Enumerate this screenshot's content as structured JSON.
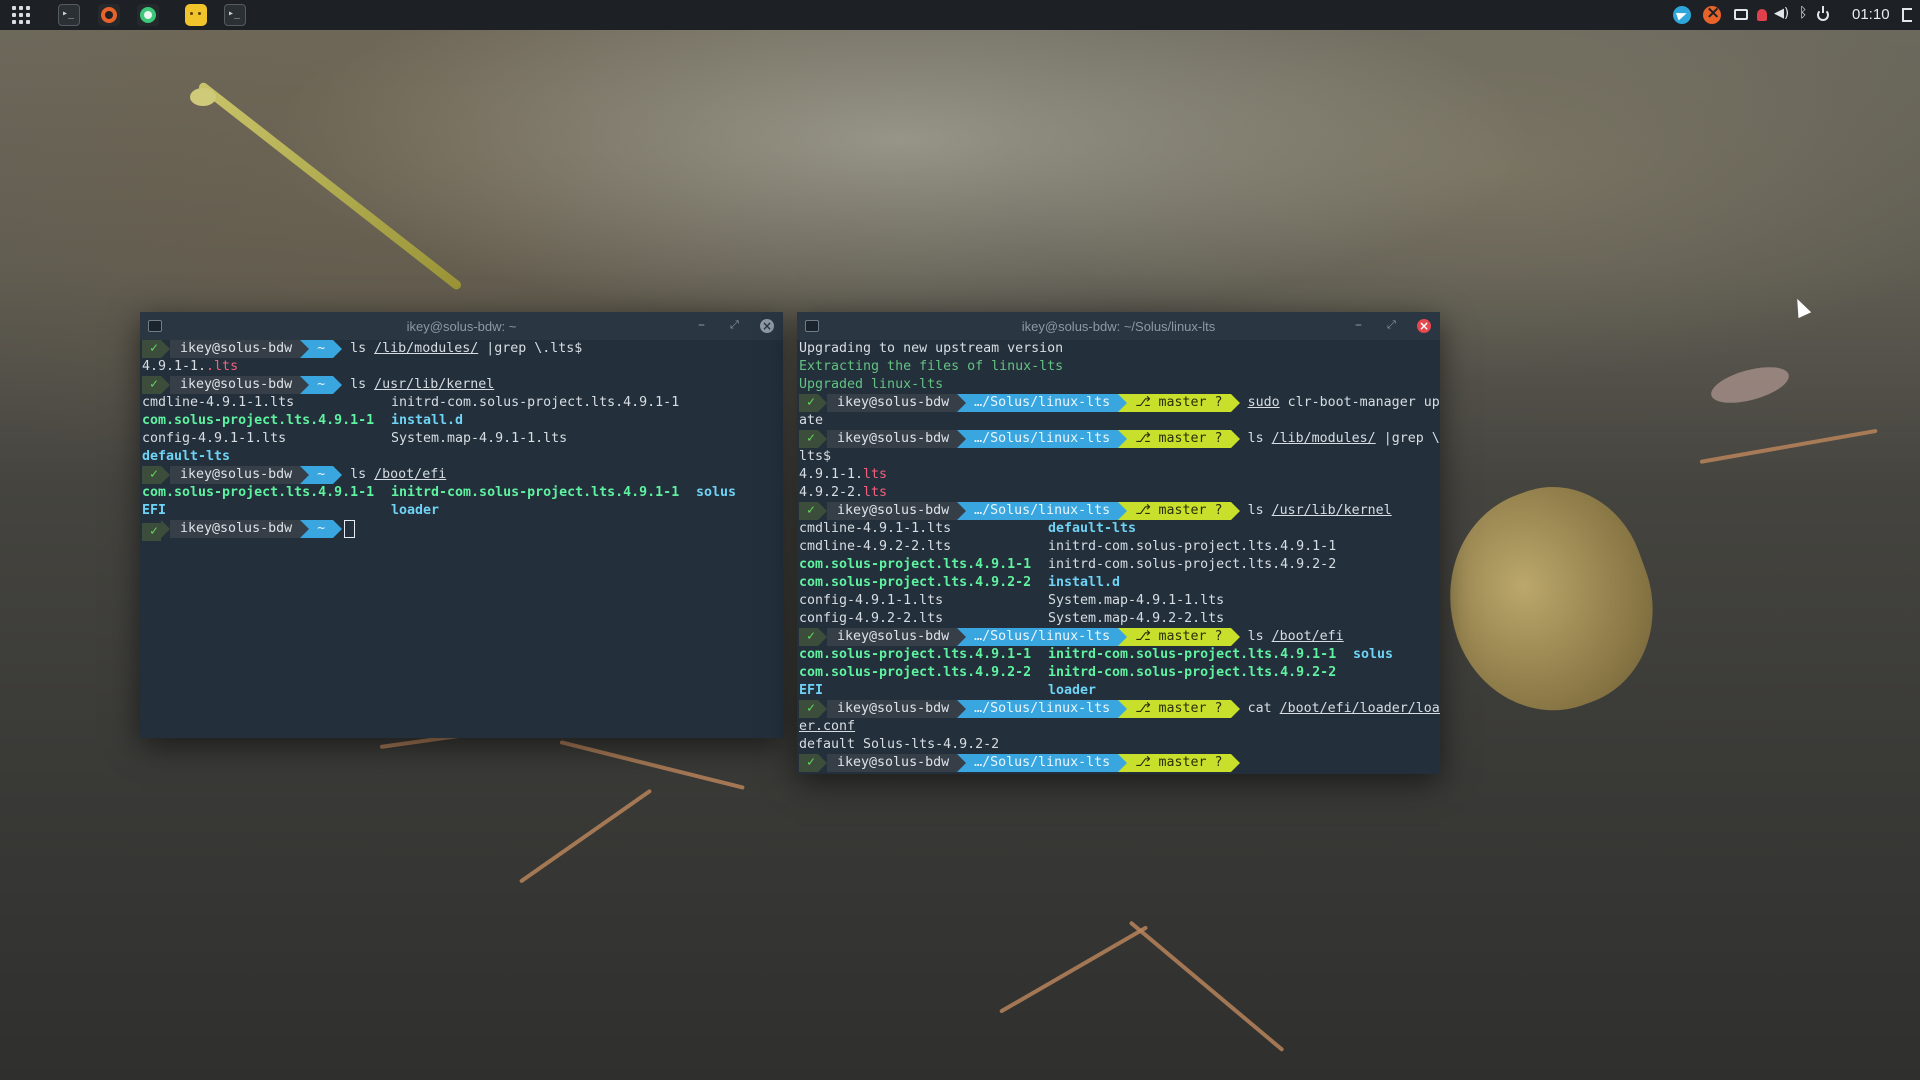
{
  "taskbar": {
    "launcher_icon": "apps-grid-icon",
    "apps": [
      {
        "name": "terminal-icon",
        "label": "▸_"
      },
      {
        "name": "hexchat-icon"
      },
      {
        "name": "chrome-green-icon"
      },
      {
        "name": "emoji-app-icon"
      },
      {
        "name": "terminal-icon",
        "label": "▸_"
      }
    ],
    "tray": [
      "telegram-icon",
      "status-x-icon",
      "screen-icon",
      "notification-bell-icon",
      "volume-icon",
      "bluetooth-icon",
      "power-icon"
    ],
    "clock": "01:10",
    "logout_icon": "logout-icon"
  },
  "colors": {
    "panel": "#1d2125",
    "terminal_bg": "#232f3a",
    "prompt_dir": "#39a6e0",
    "prompt_git": "#c8df2c",
    "exe_green": "#5ff2a0",
    "dir_cyan": "#6fd3f5"
  },
  "window1": {
    "title": "ikey@solus-bdw: ~",
    "min": "–",
    "max": "⤢",
    "close": "×",
    "lines": [
      {
        "user": "ikey@solus-bdw",
        "dir": "~",
        "cmd": "ls",
        "arg1": "/lib/modules/",
        "rest": " |grep \\.lts$"
      },
      {
        "a": "4.9.1-1.",
        "b": ".lts"
      },
      {
        "user": "ikey@solus-bdw",
        "dir": "~",
        "cmd": "ls",
        "arg1": "/usr/lib/kernel"
      },
      {
        "c1": "cmdline-4.9.1-1.lts",
        "c2": "initrd-com.solus-project.lts.4.9.1-1"
      },
      {
        "c1": "com.solus-project.lts.4.9.1-1",
        "c2": "install.d"
      },
      {
        "c1": "config-4.9.1-1.lts",
        "c2": "System.map-4.9.1-1.lts"
      },
      {
        "c1": "default-lts"
      },
      {
        "user": "ikey@solus-bdw",
        "dir": "~",
        "cmd": "ls",
        "arg1": "/boot/efi"
      },
      {
        "c1": "com.solus-project.lts.4.9.1-1",
        "c2": "initrd-com.solus-project.lts.4.9.1-1",
        "c3": "solus"
      },
      {
        "c1": "EFI",
        "c2": "loader"
      },
      {
        "user": "ikey@solus-bdw",
        "dir": "~"
      }
    ]
  },
  "window2": {
    "title": "ikey@solus-bdw: ~/Solus/linux-lts",
    "min": "–",
    "max": "⤢",
    "close": "×",
    "prompt_user": "ikey@solus-bdw",
    "prompt_dir": "…/Solus/linux-lts",
    "prompt_git": "master ?",
    "lines": [
      "Upgrading to new upstream version",
      "Extracting the files of linux-lts",
      "Upgraded linux-lts",
      {
        "cmd": "sudo",
        "rest": " clr-boot-manager upd"
      },
      "ate",
      {
        "cmd": "ls",
        "arg1": "/lib/modules/",
        "rest": " |grep \\."
      },
      "lts$",
      {
        "a": "4.9.1-1.",
        "b": "lts"
      },
      {
        "a": "4.9.2-2.",
        "b": "lts"
      },
      {
        "cmd": "ls",
        "arg1": "/usr/lib/kernel"
      },
      {
        "c1": "cmdline-4.9.1-1.lts",
        "c2": "default-lts"
      },
      {
        "c1": "cmdline-4.9.2-2.lts",
        "c2": "initrd-com.solus-project.lts.4.9.1-1"
      },
      {
        "c1": "com.solus-project.lts.4.9.1-1",
        "c2": "initrd-com.solus-project.lts.4.9.2-2"
      },
      {
        "c1": "com.solus-project.lts.4.9.2-2",
        "c2": "install.d"
      },
      {
        "c1": "config-4.9.1-1.lts",
        "c2": "System.map-4.9.1-1.lts"
      },
      {
        "c1": "config-4.9.2-2.lts",
        "c2": "System.map-4.9.2-2.lts"
      },
      {
        "cmd": "ls",
        "arg1": "/boot/efi"
      },
      {
        "c1": "com.solus-project.lts.4.9.1-1",
        "c2": "initrd-com.solus-project.lts.4.9.1-1",
        "c3": "solus"
      },
      {
        "c1": "com.solus-project.lts.4.9.2-2",
        "c2": "initrd-com.solus-project.lts.4.9.2-2"
      },
      {
        "c1": "EFI",
        "c2": "loader"
      },
      {
        "cmd": "cat",
        "arg1": "/boot/efi/loader/load"
      },
      "er.conf",
      "default Solus-lts-4.9.2-2",
      {}
    ]
  }
}
